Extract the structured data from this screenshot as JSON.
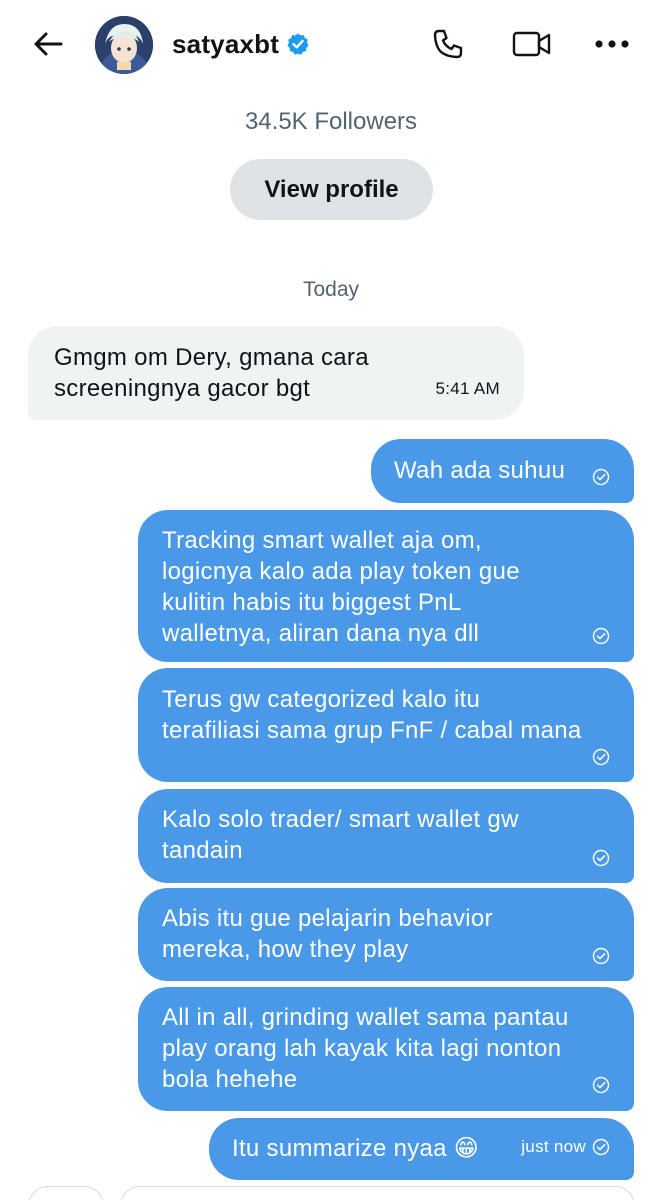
{
  "header": {
    "username": "satyaxbt",
    "verified": true,
    "icons": [
      "back-arrow-icon",
      "phone-icon",
      "video-icon",
      "more-icon"
    ]
  },
  "profile": {
    "followers": "34.5K Followers",
    "view_profile_label": "View profile"
  },
  "day_label": "Today",
  "messages": [
    {
      "direction": "incoming",
      "text": "Gmgm om Dery, gmana cara\nscreeningnya gacor bgt",
      "time": "5:41 AM"
    },
    {
      "direction": "outgoing",
      "text": "Wah ada suhuu",
      "time": ""
    },
    {
      "direction": "outgoing",
      "text": "Tracking smart wallet aja om,\nlogicnya kalo ada play token gue\nkulitin habis itu biggest PnL\nwalletnya, aliran dana nya dll",
      "time": ""
    },
    {
      "direction": "outgoing",
      "text": "Terus gw categorized kalo itu\nterafiliasi sama grup FnF / cabal mana",
      "time": ""
    },
    {
      "direction": "outgoing",
      "text": "Kalo solo trader/ smart wallet gw\ntandain",
      "time": ""
    },
    {
      "direction": "outgoing",
      "text": "Abis itu gue pelajarin behavior\nmereka, how they play",
      "time": ""
    },
    {
      "direction": "outgoing",
      "text": "All in all, grinding wallet sama pantau\nplay orang lah kayak kita lagi nonton\nbola hehehe",
      "time": ""
    },
    {
      "direction": "outgoing",
      "text": "Itu summarize nyaa 😁",
      "time": "just now"
    }
  ],
  "colors": {
    "outgoing_bubble": "#4a99e9",
    "incoming_bubble": "#eff3f4",
    "verified_badge": "#1d9bf0",
    "secondary_text": "#536471"
  }
}
